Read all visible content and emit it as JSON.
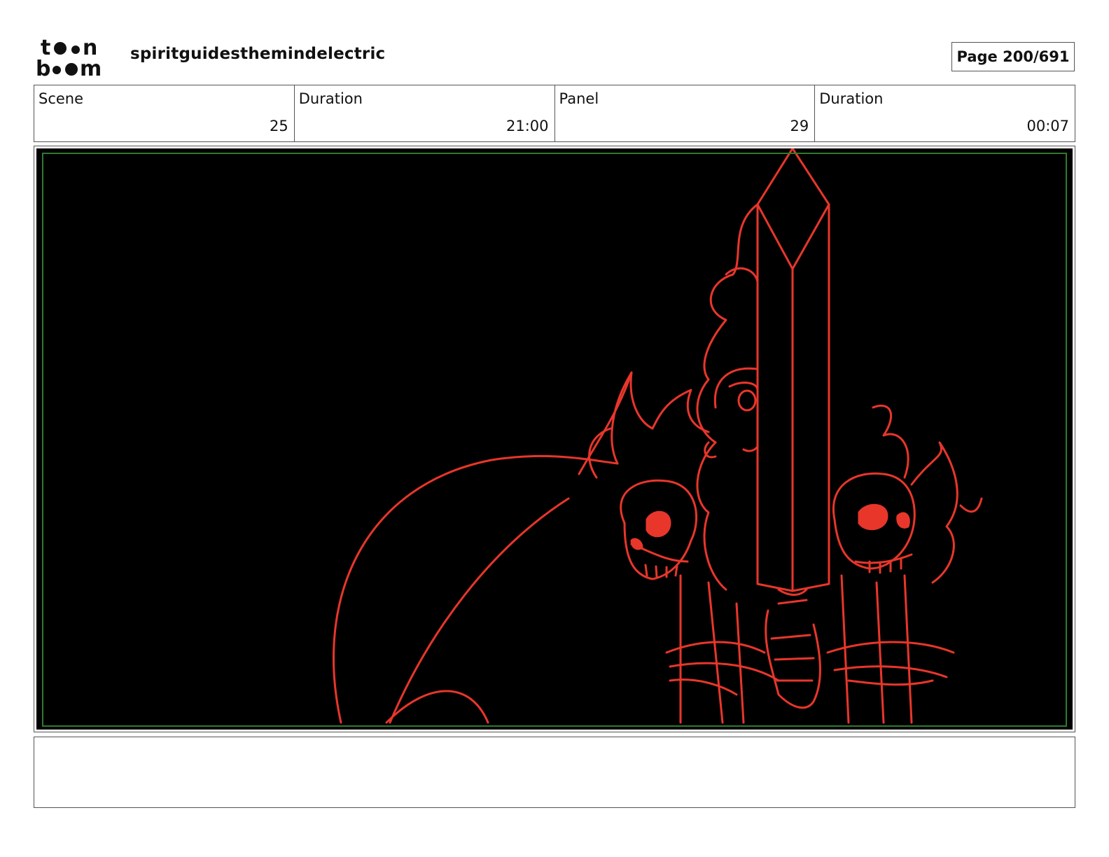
{
  "header": {
    "logo_line1": "toon",
    "logo_line2": "boom",
    "project_title": "spiritguidesthemindelectric",
    "page_label": "Page 200/691"
  },
  "info": {
    "scene_label": "Scene",
    "scene_value": "25",
    "scene_duration_label": "Duration",
    "scene_duration_value": "21:00",
    "panel_label": "Panel",
    "panel_value": "29",
    "panel_duration_label": "Duration",
    "panel_duration_value": "00:07"
  },
  "panel": {
    "background_color": "#000000",
    "line_color": "#e8362b",
    "safe_frame_color": "#2f7a2f"
  },
  "notes": {
    "text": ""
  }
}
